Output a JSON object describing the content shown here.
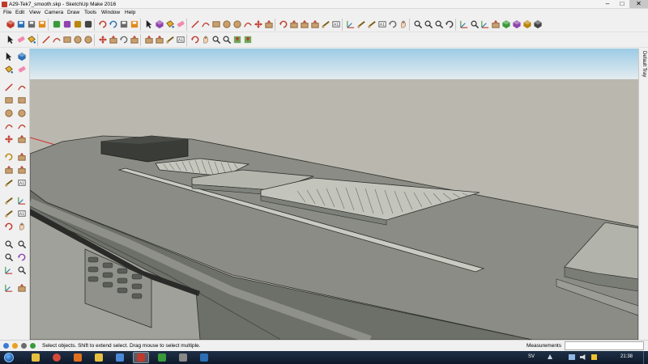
{
  "window": {
    "title": "A29-Tek7_smooth.skp - SketchUp Make 2016",
    "min_glyph": "–",
    "max_glyph": "□",
    "close_glyph": "✕"
  },
  "menu": {
    "items": [
      "File",
      "Edit",
      "View",
      "Camera",
      "Draw",
      "Tools",
      "Window",
      "Help"
    ]
  },
  "tray": {
    "label": "Default Tray"
  },
  "status": {
    "text": "Select objects. Shift to extend select. Drag mouse to select multiple.",
    "measurements_label": "Measurements",
    "measurements_value": ""
  },
  "taskbar": {
    "language": "SV",
    "time": "21:38"
  },
  "colors": {
    "sky_top": "#a9cfe6",
    "sky_bottom": "#e6eef2",
    "ground": "#b8b6ad",
    "model_top": "#8d8f88",
    "model_dark": "#3b3d39",
    "axis_red": "#d03030"
  },
  "icons": {
    "toolbar_row1": [
      "getting-started-icon",
      "new-file-icon",
      "open-file-icon",
      "save-icon",
      "cut-icon",
      "copy-icon",
      "paste-icon",
      "erase-icon",
      "undo-icon",
      "redo-icon",
      "print-icon",
      "model-info-icon",
      "select-icon",
      "component-icon",
      "paint-icon",
      "eraser-icon",
      "line-icon",
      "arc-icon",
      "rectangle-icon",
      "circle-icon",
      "polygon-icon",
      "freehand-icon",
      "move-icon",
      "pushpull-icon",
      "rotate-icon",
      "followme-icon",
      "scale-icon",
      "offset-icon",
      "tape-icon",
      "text-icon",
      "axes-icon",
      "dimension-icon",
      "protractor-icon",
      "3dtext-icon",
      "orbit-icon",
      "pan-icon",
      "zoom-icon",
      "zoom-window-icon",
      "zoom-extents-icon",
      "previous-view-icon",
      "walk-icon",
      "look-around-icon",
      "position-camera-icon",
      "section-plane-icon",
      "warehouse-icon",
      "share-model-icon",
      "extension-icon",
      "layout-icon"
    ],
    "toolbar_row2": [
      "select-icon",
      "eraser-icon",
      "paint-icon",
      "line-icon",
      "arc-icon",
      "rectangle-icon",
      "circle-icon",
      "polygon-icon",
      "move-icon",
      "pushpull-icon",
      "rotate-icon",
      "followme-icon",
      "scale-icon",
      "offset-icon",
      "tape-icon",
      "text-icon",
      "orbit-icon",
      "pan-icon",
      "zoom-icon",
      "zoom-extents-icon",
      "geolocate-icon",
      "add-location-icon"
    ],
    "left_tools": [
      "select-icon",
      "component-icon",
      "paint-icon",
      "eraser-icon",
      "line-icon",
      "freehand-icon",
      "rectangle-icon",
      "rotated-rect-icon",
      "circle-icon",
      "polygon-icon",
      "arc-icon",
      "pie-icon",
      "move-icon",
      "pushpull-icon",
      "rotate-icon",
      "followme-icon",
      "scale-icon",
      "offset-icon",
      "tape-icon",
      "text-icon",
      "protractor-icon",
      "axes-icon",
      "dimension-icon",
      "3dtext-icon",
      "orbit-icon",
      "pan-icon",
      "zoom-icon",
      "zoom-window-icon",
      "zoom-extents-icon",
      "previous-icon",
      "position-camera-icon",
      "look-around-icon",
      "walk-icon",
      "section-plane-icon"
    ],
    "taskbar_apps": [
      "explorer-icon",
      "chrome-icon",
      "media-icon",
      "folder-icon",
      "photo-icon",
      "sketchup-icon",
      "paint-icon",
      "calc-icon",
      "ie-icon"
    ]
  }
}
